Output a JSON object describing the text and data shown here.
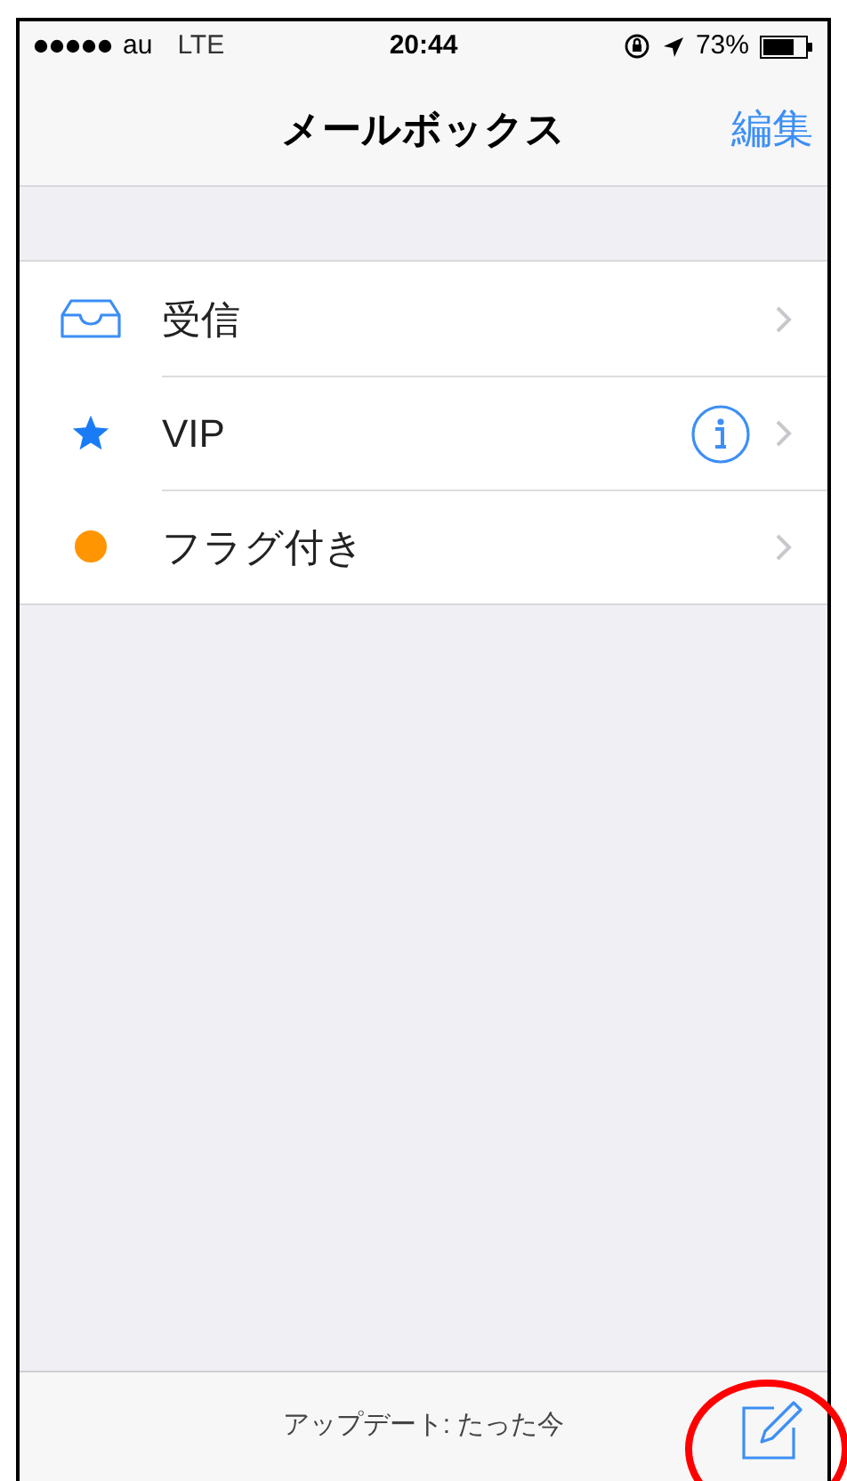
{
  "status_bar": {
    "carrier": "au",
    "network": "LTE",
    "time": "20:44",
    "battery": "73%"
  },
  "nav_bar": {
    "title": "メールボックス",
    "edit_button": "編集"
  },
  "mailboxes": [
    {
      "kind": "inbox",
      "label": "受信",
      "info_button": false
    },
    {
      "kind": "vip",
      "label": "VIP",
      "info_button": true
    },
    {
      "kind": "flagged",
      "label": "フラグ付き",
      "info_button": false
    }
  ],
  "toolbar": {
    "status": "アップデート: たった今",
    "compose_highlighted": true
  }
}
